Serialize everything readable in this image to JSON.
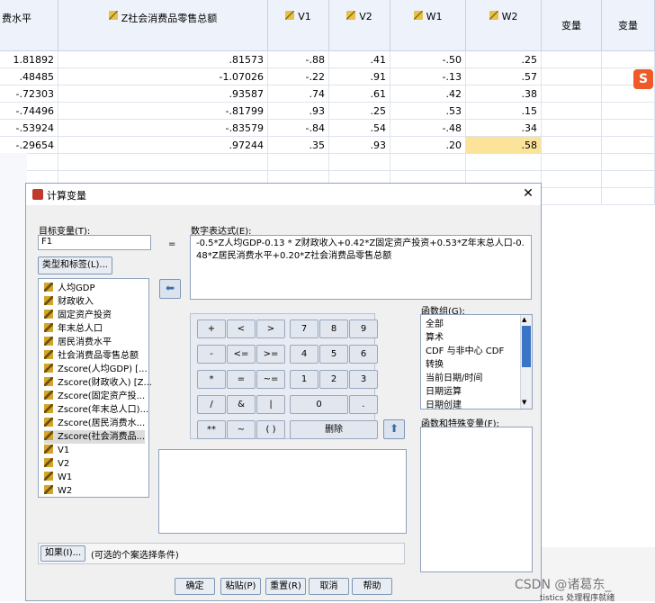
{
  "grid": {
    "first_col_header": "费水平",
    "headers": [
      "Z社会消费品零售总额",
      "V1",
      "V2",
      "W1",
      "W2",
      "变量",
      "变量"
    ],
    "rows": [
      [
        "1.81892",
        ".81573",
        "-.88",
        ".41",
        "-.50",
        ".25"
      ],
      [
        ".48485",
        "-1.07026",
        "-.22",
        ".91",
        "-.13",
        ".57"
      ],
      [
        "-.72303",
        ".93587",
        ".74",
        ".61",
        ".42",
        ".38"
      ],
      [
        "-.74496",
        "-.81799",
        ".93",
        ".25",
        ".53",
        ".15"
      ],
      [
        "-.53924",
        "-.83579",
        "-.84",
        ".54",
        "-.48",
        ".34"
      ],
      [
        "-.29654",
        ".97244",
        ".35",
        ".93",
        ".20",
        ".58"
      ]
    ]
  },
  "dialog": {
    "title": "计算变量",
    "target_label": "目标变量(T):",
    "target_value": "F1",
    "equals": "=",
    "type_label_button": "类型和标签(L)...",
    "expr_label": "数字表达式(E):",
    "expression": "-0.5*Z人均GDP-0.13 * Z财政收入+0.42*Z固定资产投资+0.53*Z年末总人口-0.48*Z居民消费水平+0.20*Z社会消费品零售总额",
    "variables": [
      "人均GDP",
      "财政收入",
      "固定资产投资",
      "年末总人口",
      "居民消费水平",
      "社会消费品零售总额",
      "Zscore(人均GDP) [...",
      "Zscore(财政收入) [Z...",
      "Zscore(固定资产投...",
      "Zscore(年末总人口)...",
      "Zscore(居民消费水...",
      "Zscore(社会消费品...",
      "V1",
      "V2",
      "W1",
      "W2"
    ],
    "keypad": [
      [
        "+",
        "<",
        ">",
        "7",
        "8",
        "9"
      ],
      [
        "-",
        "<=",
        ">=",
        "4",
        "5",
        "6"
      ],
      [
        "*",
        "=",
        "~=",
        "1",
        "2",
        "3"
      ],
      [
        "/",
        "&",
        "|",
        "0",
        "."
      ],
      [
        "**",
        "~",
        "( )",
        "删除"
      ]
    ],
    "func_group_label": "函数组(G):",
    "func_groups": [
      "全部",
      "算术",
      "CDF 与非中心 CDF",
      "转换",
      "当前日期/时间",
      "日期运算",
      "日期创建"
    ],
    "func_vars_label": "函数和特殊变量(F):",
    "if_button": "如果(I)...",
    "if_hint": "(可选的个案选择条件)",
    "buttons": [
      "确定",
      "粘贴(P)",
      "重置(R)",
      "取消",
      "帮助"
    ]
  },
  "taskbar": {
    "watermark": "CSDN @诸葛东_",
    "status_text": "tistics 处理程序就绪"
  },
  "colors": {
    "highlight_cell": "#fbe39a",
    "header_bg": "#eef3fb"
  }
}
